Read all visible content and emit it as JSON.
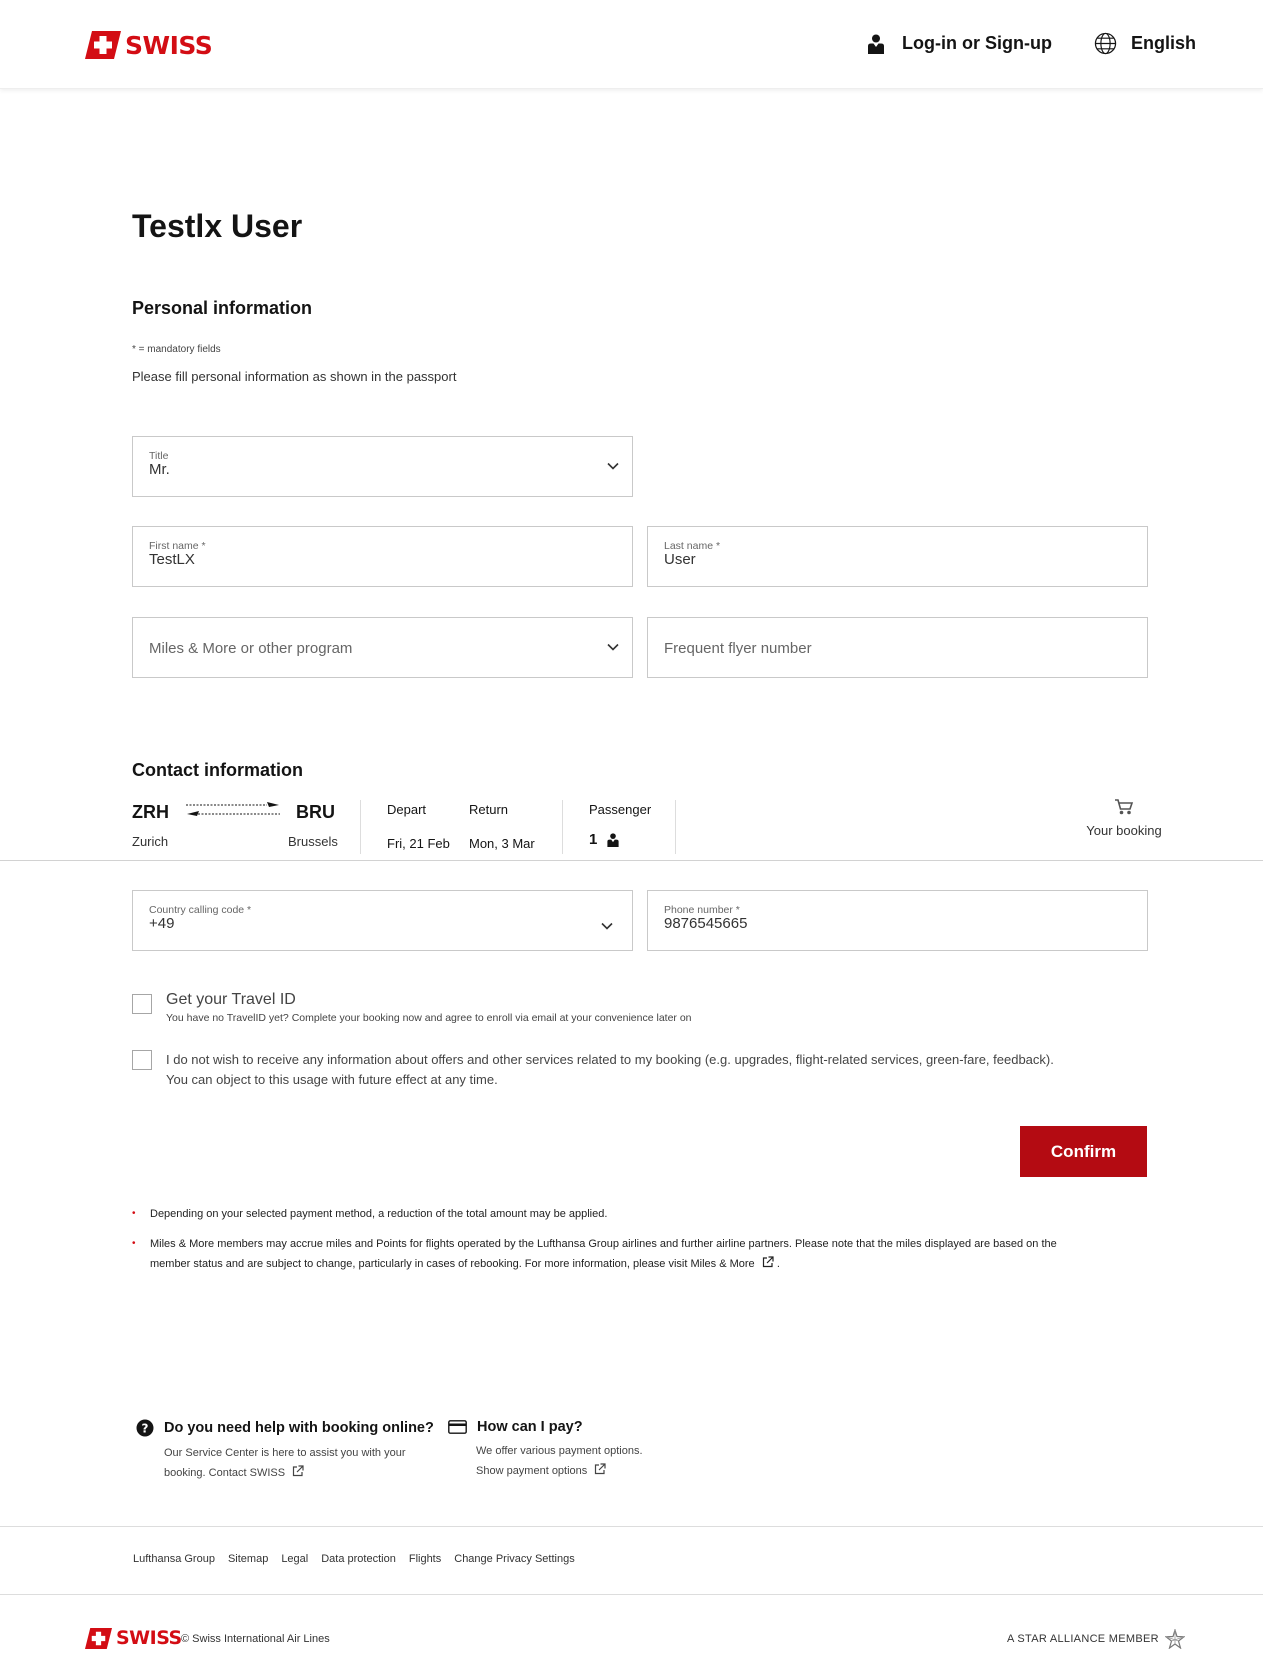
{
  "header": {
    "brand": "SWISS",
    "login_label": "Log-in or Sign-up",
    "language_label": "English"
  },
  "page": {
    "title": "Testlx User"
  },
  "personal": {
    "section_title": "Personal information",
    "mandatory_note": "* = mandatory fields",
    "fill_note": "Please fill personal information as shown in the passport",
    "title_field": {
      "label": "Title",
      "value": "Mr."
    },
    "first_name": {
      "label": "First name *",
      "value": "TestLX"
    },
    "last_name": {
      "label": "Last name *",
      "value": "User"
    },
    "program_placeholder": "Miles & More or other program",
    "ff_number_placeholder": "Frequent flyer number"
  },
  "contact": {
    "section_title": "Contact information",
    "calling_code": {
      "label": "Country calling code *",
      "value": "+49"
    },
    "phone": {
      "label": "Phone number *",
      "value": "9876545665"
    }
  },
  "booking_bar": {
    "origin_code": "ZRH",
    "origin_city": "Zurich",
    "destination_code": "BRU",
    "destination_city": "Brussels",
    "depart_label": "Depart",
    "depart_value": "Fri, 21 Feb",
    "return_label": "Return",
    "return_value": "Mon, 3 Mar",
    "passenger_label": "Passenger",
    "passenger_count": "1",
    "your_booking_label": "Your booking"
  },
  "checkboxes": {
    "travel_id_title": "Get your Travel ID",
    "travel_id_sub": "You have no TravelID yet? Complete your booking now and agree to enroll via email at your convenience later on",
    "optout_line1": "I do not wish to receive any information about offers and other services related to my booking (e.g. upgrades, flight-related services, green-fare, feedback).",
    "optout_line2": "You can object to this usage with future effect at any time."
  },
  "confirm_label": "Confirm",
  "footnotes": {
    "note1": "Depending on your selected payment method, a reduction of the total amount may be applied.",
    "note2_line1": "Miles & More members may accrue miles and Points for flights operated by the Lufthansa Group airlines and further airline partners. Please note that the miles displayed are based on the",
    "note2_line2": "member status and are subject to change, particularly in cases of rebooking. For more information, please visit",
    "note2_link": "Miles & More",
    "note2_end": "."
  },
  "help": {
    "booking_title": "Do you need help with booking online?",
    "booking_text1": "Our Service Center is here to assist you with your",
    "booking_text2": "booking.",
    "booking_link": "Contact SWISS",
    "pay_title": "How can I pay?",
    "pay_text": "We offer various payment options.",
    "pay_link": "Show payment options"
  },
  "footer": {
    "links": [
      "Lufthansa Group",
      "Sitemap",
      "Legal",
      "Data protection",
      "Flights",
      "Change Privacy Settings"
    ],
    "brand": "SWISS",
    "copyright": "© Swiss International Air Lines",
    "alliance": "A STAR ALLIANCE MEMBER"
  },
  "colors": {
    "brand_red": "#d30d14",
    "button_red": "#b40b12"
  },
  "icons": [
    "swiss-cross-icon",
    "user-icon",
    "globe-icon",
    "chevron-down-icon",
    "plane-icon",
    "passenger-icon",
    "cart-icon",
    "help-icon",
    "credit-card-icon",
    "external-link-icon",
    "star-alliance-icon"
  ]
}
